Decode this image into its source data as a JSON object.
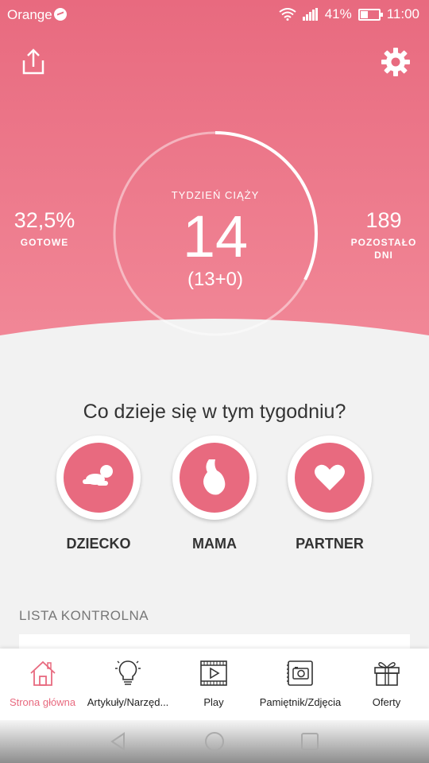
{
  "status": {
    "carrier": "Orange",
    "battery": "41%",
    "time": "11:00",
    "battery_level": 0.41
  },
  "header": {
    "share_icon": "share-icon",
    "settings_icon": "gear-icon"
  },
  "progress": {
    "week_label": "TYDZIEŃ CIĄŻY",
    "week": "14",
    "week_detail": "(13+0)",
    "percent_value": "32,5%",
    "percent_label": "GOTOWE",
    "ring_fraction": 0.325,
    "days_value": "189",
    "days_label_line1": "POZOSTAŁO",
    "days_label_line2": "DNI"
  },
  "weekly": {
    "question": "Co dzieje się w tym tygodniu?",
    "topics": [
      {
        "label": "DZIECKO",
        "icon": "crawling-baby-icon"
      },
      {
        "label": "MAMA",
        "icon": "pregnant-belly-icon"
      },
      {
        "label": "PARTNER",
        "icon": "heart-icon"
      }
    ]
  },
  "checklist": {
    "title": "LISTA KONTROLNA"
  },
  "bottom_nav": {
    "items": [
      {
        "label": "Strona główna",
        "icon": "home-icon",
        "active": true
      },
      {
        "label": "Artykuły/Narzęd...",
        "icon": "lightbulb-icon",
        "active": false
      },
      {
        "label": "Play",
        "icon": "video-play-icon",
        "active": false
      },
      {
        "label": "Pamiętnik/Zdjęcia",
        "icon": "camera-icon",
        "active": false
      },
      {
        "label": "Oferty",
        "icon": "gift-icon",
        "active": false
      }
    ]
  },
  "colors": {
    "accent": "#e86a7f",
    "hero_gradient_end": "#f28a99",
    "background": "#f2f2f2"
  }
}
